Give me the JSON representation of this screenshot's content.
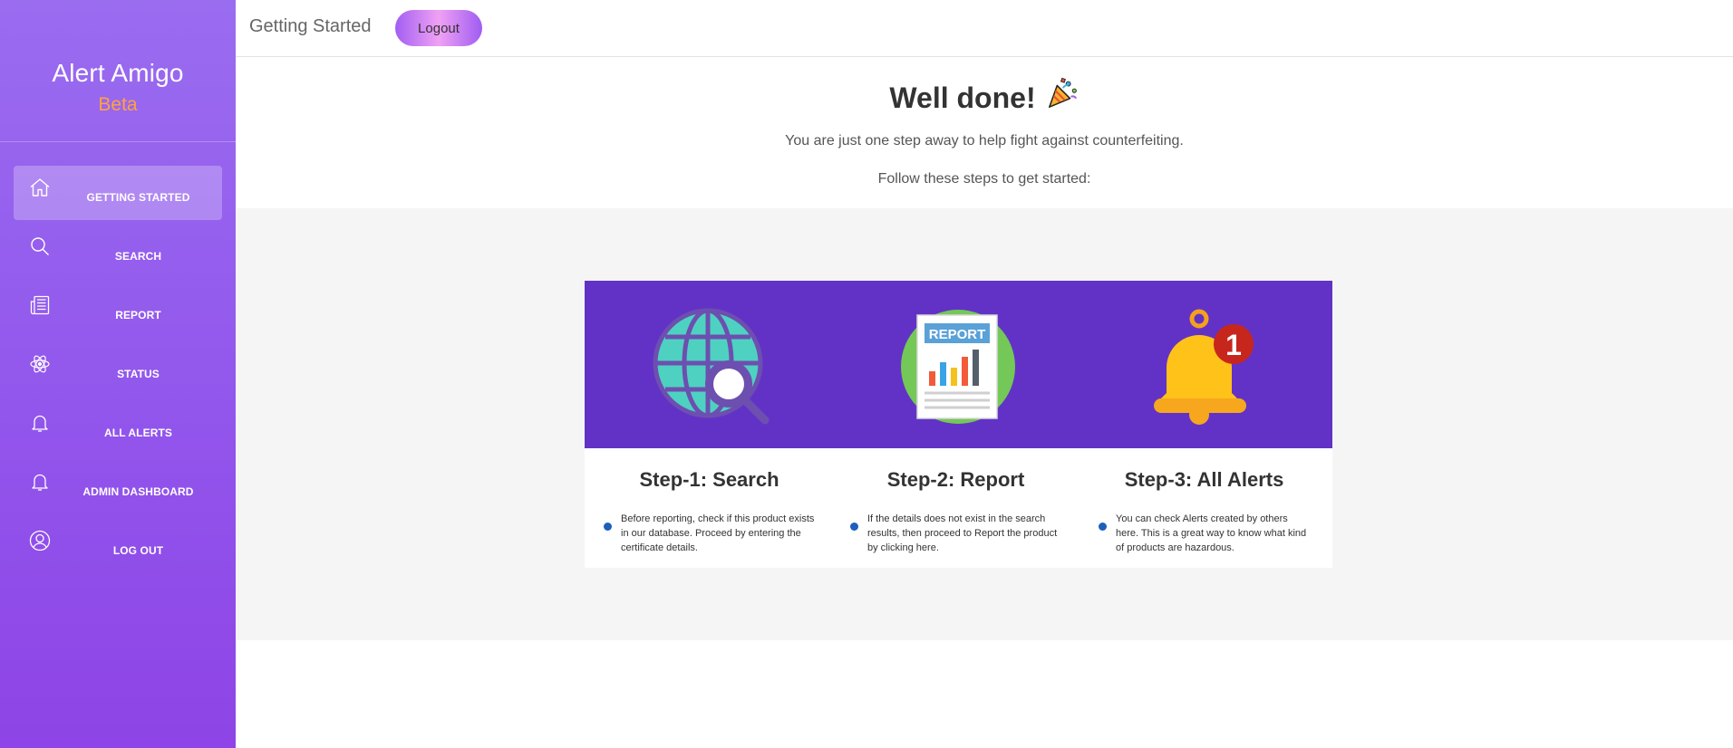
{
  "app": {
    "name": "Alert Amigo",
    "tag": "Beta"
  },
  "sidebar": {
    "items": [
      {
        "label": "GETTING STARTED",
        "icon": "home-icon",
        "active": true
      },
      {
        "label": "SEARCH",
        "icon": "search-icon"
      },
      {
        "label": "REPORT",
        "icon": "newspaper-icon"
      },
      {
        "label": "STATUS",
        "icon": "atom-icon"
      },
      {
        "label": "ALL ALERTS",
        "icon": "bell-icon"
      },
      {
        "label": "ADMIN DASHBOARD",
        "icon": "bell-icon"
      },
      {
        "label": "LOG OUT",
        "icon": "user-circle-icon"
      }
    ]
  },
  "header": {
    "title": "Getting Started",
    "logout_label": "Logout"
  },
  "hero": {
    "title": "Well done!",
    "subtitle": "You are just one step away to help fight against counterfeiting.",
    "instruction": "Follow these steps to get started:"
  },
  "banner": {
    "report_badge": "REPORT",
    "notification_count": "1"
  },
  "steps": [
    {
      "title": "Step-1: Search",
      "body": "Before reporting, check if this product exists in our database. Proceed by entering the certificate details."
    },
    {
      "title": "Step-2: Report",
      "body": "If the details does not exist in the search results, then proceed to Report the product by clicking here."
    },
    {
      "title": "Step-3: All Alerts",
      "body": "You can check Alerts created by others here. This is a great way to know what kind of products are hazardous."
    }
  ],
  "colors": {
    "sidebar_top": "#9a6cf0",
    "sidebar_bottom": "#8e44e6",
    "beta": "#ffa23e",
    "banner": "#6232c7",
    "bullet": "#1d5fbd"
  }
}
